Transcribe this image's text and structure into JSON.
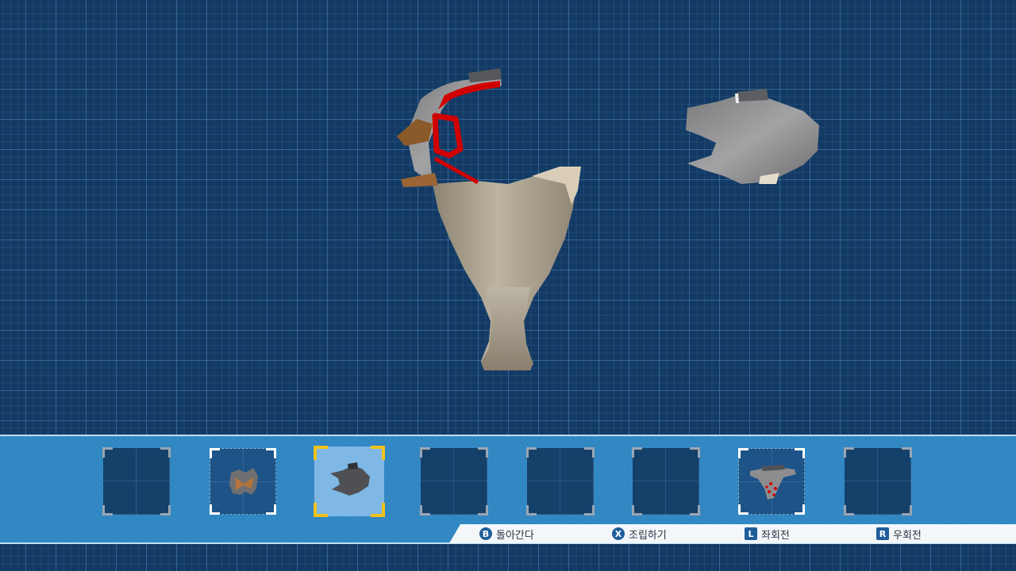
{
  "stage": {
    "pieces": [
      "vase-assembled",
      "vase-shard"
    ]
  },
  "tray": {
    "slots": [
      {
        "state": "empty"
      },
      {
        "state": "filled",
        "piece": "small-bowtie-shard"
      },
      {
        "state": "selected",
        "piece": "gray-jagged-shard"
      },
      {
        "state": "empty"
      },
      {
        "state": "empty"
      },
      {
        "state": "empty"
      },
      {
        "state": "filled",
        "piece": "rim-shard-with-red-marks"
      },
      {
        "state": "empty"
      }
    ]
  },
  "hints": {
    "back": {
      "key": "B",
      "label": "돌아간다"
    },
    "assemble": {
      "key": "X",
      "label": "조립하기"
    },
    "rotate_left": {
      "key": "L",
      "label": "좌회전"
    },
    "rotate_right": {
      "key": "R",
      "label": "우회전"
    }
  },
  "colors": {
    "accent": "#f2c21a",
    "grid_bg": "#123a64",
    "tray": "#2f86c2",
    "highlight_red": "#d10000"
  }
}
